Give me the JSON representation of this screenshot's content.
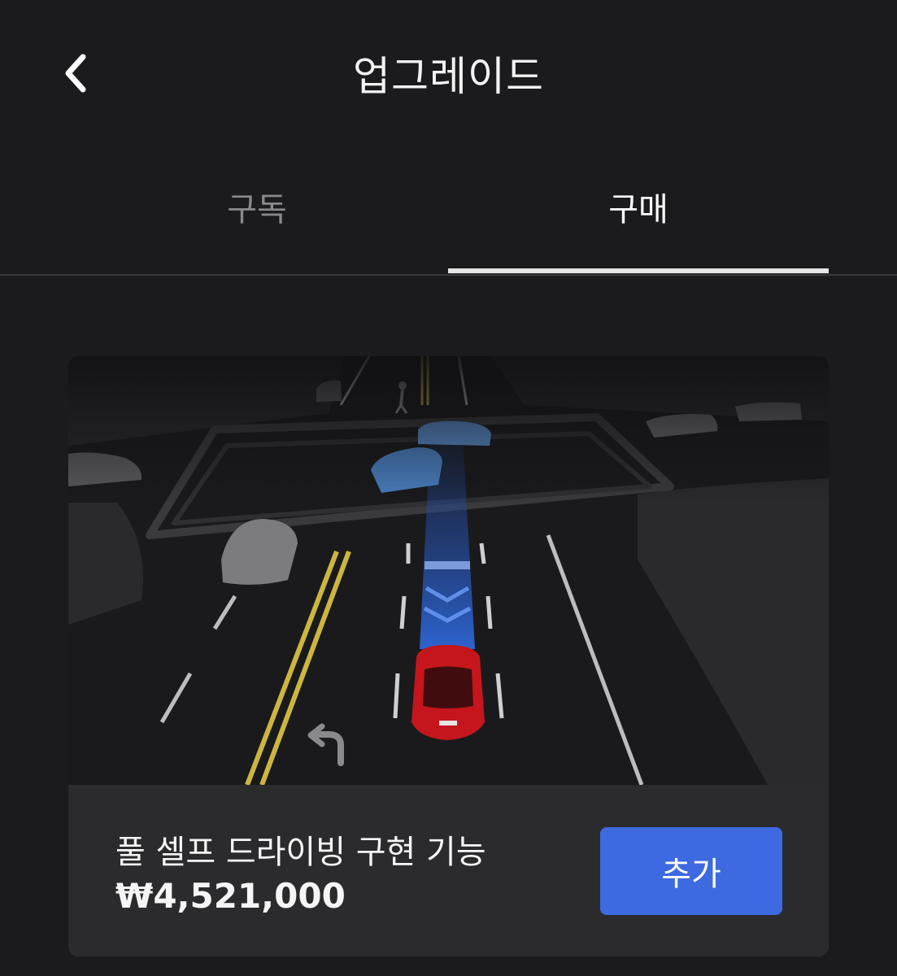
{
  "header": {
    "title": "업그레이드",
    "back_icon": "chevron-left-icon"
  },
  "tabs": [
    {
      "label": "구독",
      "active": false
    },
    {
      "label": "구매",
      "active": true
    }
  ],
  "product": {
    "name": "풀 셀프 드라이빙 구현 기능",
    "price": "₩4,521,000",
    "add_label": "추가"
  },
  "colors": {
    "background": "#1b1b1d",
    "card": "#2b2b2d",
    "accent": "#3e6ae1",
    "ego_car": "#c4161c",
    "lead_vehicle": "#4a7fc0",
    "lane_line": "#d9c24a"
  }
}
